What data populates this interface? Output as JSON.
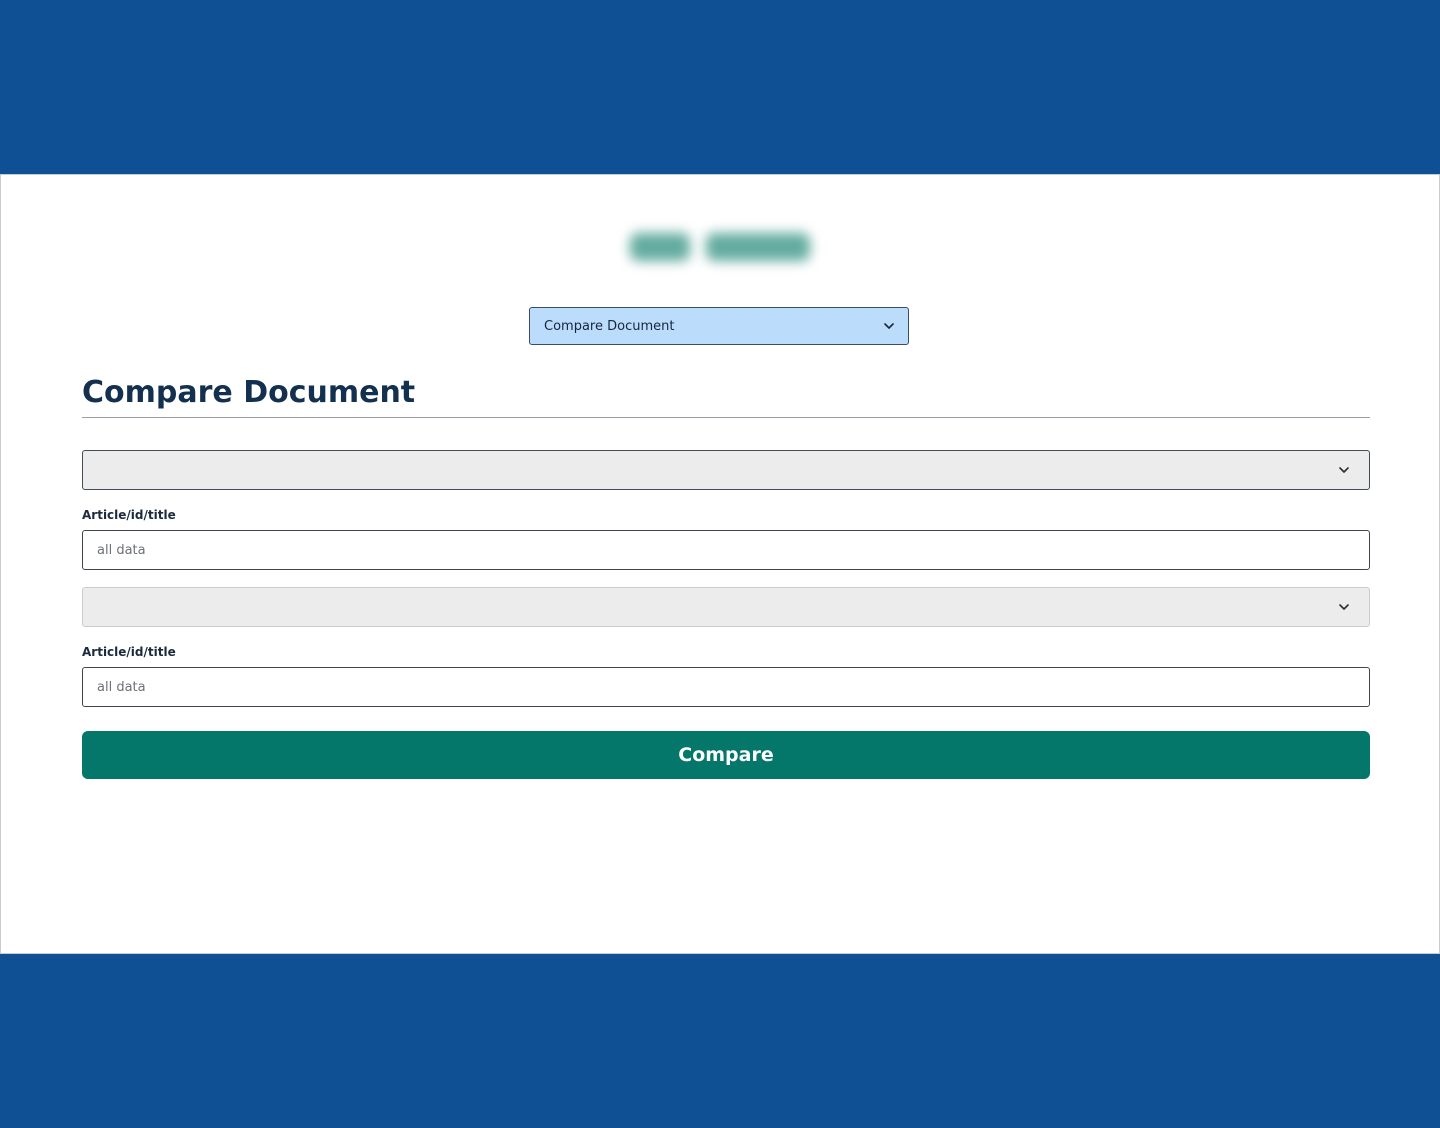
{
  "mode_select": {
    "selected": "Compare Document"
  },
  "page": {
    "title": "Compare Document"
  },
  "form": {
    "source_1": {
      "selected": "",
      "label": "Article/id/title",
      "placeholder": "all data"
    },
    "source_2": {
      "selected": "",
      "label": "Article/id/title",
      "placeholder": "all data"
    },
    "submit_label": "Compare"
  },
  "colors": {
    "background": "#0f4f94",
    "panel": "#ffffff",
    "mode_select_bg": "#bcdcfb",
    "heading": "#13304f",
    "button": "#05776a",
    "dropdown_bg": "#ececec"
  },
  "icons": {
    "logo": "blurred-brand-logo",
    "dropdown": "chevron-down-icon"
  }
}
